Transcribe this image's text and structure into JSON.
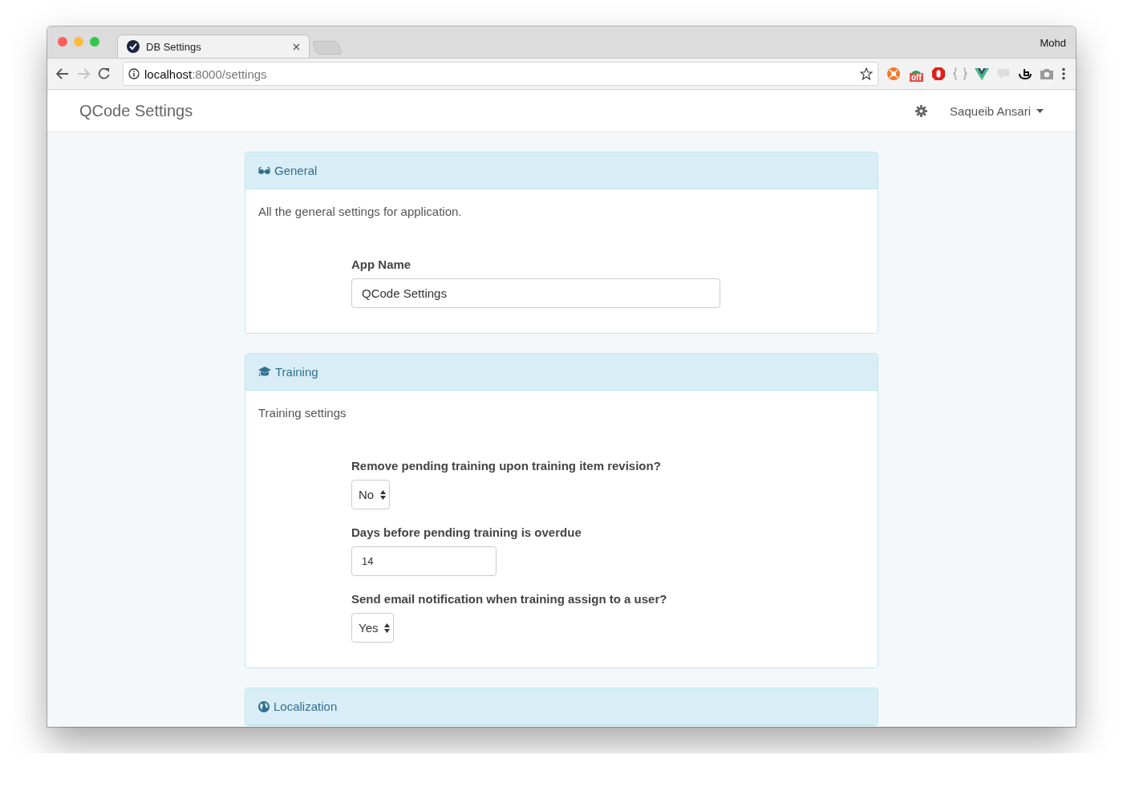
{
  "browser": {
    "tabs": [
      {
        "title": "DB Settings",
        "selected": true
      },
      {
        "selected": false
      }
    ],
    "profile": "Mohd",
    "address": {
      "host": "localhost",
      "path": ":8000/settings"
    },
    "extension_badge": "off"
  },
  "navbar": {
    "brand": "QCode Settings",
    "user": "Saqueib Ansari"
  },
  "panels": [
    {
      "title": "General",
      "description": "All the general settings for application.",
      "fields": [
        {
          "kind": "text",
          "label": "App Name",
          "value": "QCode Settings"
        }
      ]
    },
    {
      "title": "Training",
      "description": "Training settings",
      "fields": [
        {
          "kind": "select",
          "label": "Remove pending training upon training item revision?",
          "value": "No"
        },
        {
          "kind": "number",
          "label": "Days before pending training is overdue",
          "value": "14"
        },
        {
          "kind": "select",
          "label": "Send email notification when training assign to a user?",
          "value": "Yes"
        }
      ]
    },
    {
      "title": "Localization"
    }
  ]
}
